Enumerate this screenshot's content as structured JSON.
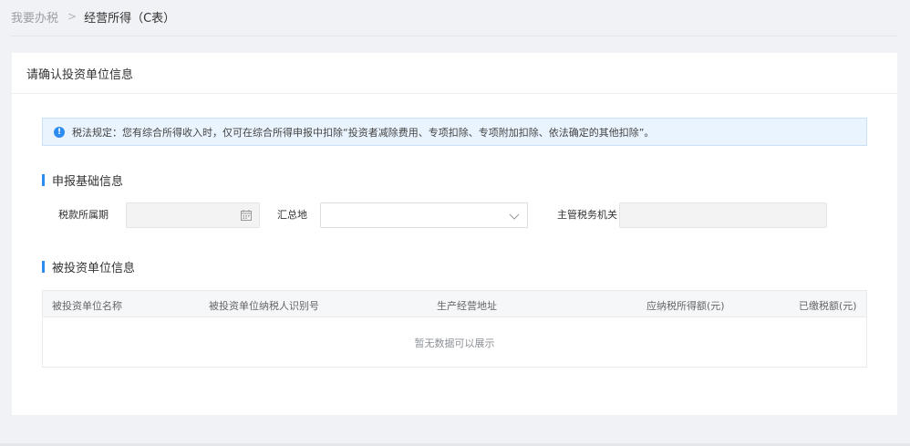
{
  "breadcrumb": {
    "home": "我要办税",
    "separator": ">",
    "current": "经营所得（C表）"
  },
  "card": {
    "title": "请确认投资单位信息"
  },
  "notice": {
    "icon": "info-icon",
    "icon_glyph": "!",
    "text": "税法规定：您有综合所得收入时，仅可在综合所得申报中扣除“投资者减除费用、专项扣除、专项附加扣除、依法确定的其他扣除”。"
  },
  "basic_info": {
    "title": "申报基础信息",
    "tax_period_label": "税款所属期",
    "tax_period_value": "",
    "summary_place_label": "汇总地",
    "summary_place_value": "",
    "tax_authority_label": "主管税务机关",
    "tax_authority_value": ""
  },
  "invested_units": {
    "title": "被投资单位信息",
    "columns": [
      "被投资单位名称",
      "被投资单位纳税人识别号",
      "生产经营地址",
      "应纳税所得额(元)",
      "已缴税额(元)"
    ],
    "empty_text": "暂无数据可以展示"
  },
  "colors": {
    "accent": "#2d8cf0",
    "notice_bg": "#eaf4fe",
    "page_bg": "#f1f2f5"
  }
}
